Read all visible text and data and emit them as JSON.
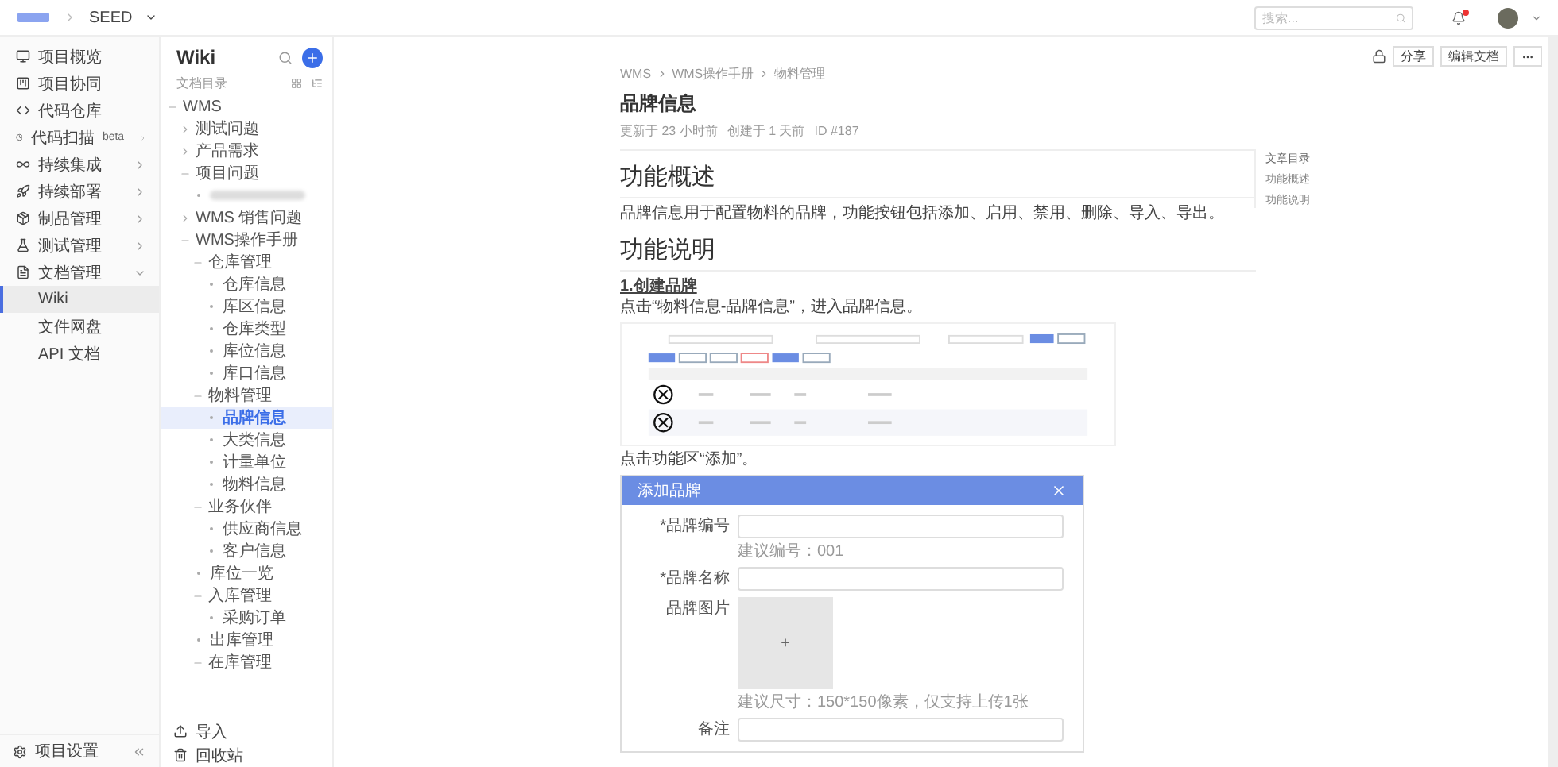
{
  "topbar": {
    "breadcrumb": [
      "SEED"
    ],
    "search": {
      "placeholder": "搜索..."
    },
    "notifications": {
      "unread": true
    }
  },
  "nav": {
    "items": [
      {
        "label": "项目概览",
        "selected": false
      },
      {
        "label": "项目协同",
        "selected": false
      },
      {
        "label": "代码仓库",
        "selected": false
      },
      {
        "label": "代码扫描",
        "badge": "beta",
        "selected": false,
        "expanded": false
      },
      {
        "label": "持续集成",
        "selected": false,
        "expanded": false
      },
      {
        "label": "持续部署",
        "selected": false,
        "expanded": false
      },
      {
        "label": "制品管理",
        "selected": false,
        "expanded": false
      },
      {
        "label": "测试管理",
        "selected": false,
        "expanded": false
      },
      {
        "label": "文档管理",
        "selected": false,
        "expanded": true,
        "children": [
          {
            "label": "Wiki",
            "selected": true
          },
          {
            "label": "文件网盘",
            "selected": false
          },
          {
            "label": "API 文档",
            "selected": false
          }
        ]
      }
    ],
    "settings": "项目设置"
  },
  "wiki": {
    "title": "Wiki",
    "toc_label": "文档目录",
    "tree": [
      {
        "label": "WMS",
        "expanded": true,
        "selected": false,
        "children": [
          {
            "label": "测试问题",
            "expanded": false,
            "selected": false
          },
          {
            "label": "产品需求",
            "expanded": false,
            "selected": false
          },
          {
            "label": "项目问题",
            "expanded": true,
            "selected": false,
            "children": [
              {
                "redacted": true,
                "selected": false
              }
            ]
          },
          {
            "label": "WMS 销售问题",
            "expanded": false,
            "selected": false
          },
          {
            "label": "WMS操作手册",
            "expanded": true,
            "selected": false,
            "children": [
              {
                "label": "仓库管理",
                "expanded": true,
                "selected": false,
                "children": [
                  {
                    "label": "仓库信息",
                    "selected": false
                  },
                  {
                    "label": "库区信息",
                    "selected": false
                  },
                  {
                    "label": "仓库类型",
                    "selected": false
                  },
                  {
                    "label": "库位信息",
                    "selected": false
                  },
                  {
                    "label": "库口信息",
                    "selected": false
                  }
                ]
              },
              {
                "label": "物料管理",
                "expanded": true,
                "selected": false,
                "children": [
                  {
                    "label": "品牌信息",
                    "selected": true
                  },
                  {
                    "label": "大类信息",
                    "selected": false
                  },
                  {
                    "label": "计量单位",
                    "selected": false
                  },
                  {
                    "label": "物料信息",
                    "selected": false
                  }
                ]
              },
              {
                "label": "业务伙伴",
                "expanded": true,
                "selected": false,
                "children": [
                  {
                    "label": "供应商信息",
                    "selected": false
                  },
                  {
                    "label": "客户信息",
                    "selected": false
                  }
                ]
              },
              {
                "label": "库位一览",
                "selected": false
              },
              {
                "label": "入库管理",
                "expanded": true,
                "selected": false,
                "children": [
                  {
                    "label": "采购订单",
                    "selected": false
                  }
                ]
              },
              {
                "label": "出库管理",
                "selected": false
              },
              {
                "label": "在库管理",
                "expanded": true,
                "selected": false
              }
            ]
          }
        ]
      }
    ],
    "footer": [
      "导入",
      "回收站"
    ]
  },
  "doc": {
    "breadcrumb": [
      "WMS",
      "WMS操作手册",
      "物料管理"
    ],
    "title": "品牌信息",
    "meta": [
      "更新于 23 小时前",
      "创建于 1 天前",
      "ID #187"
    ],
    "actions": [
      "分享",
      "编辑文档"
    ],
    "toc": {
      "title": "文章目录",
      "items": [
        "功能概述",
        "功能说明"
      ]
    },
    "blocks": [
      {
        "kind": "heading",
        "text": "功能概述"
      },
      {
        "kind": "paragraph",
        "text": "品牌信息用于配置物料的品牌，功能按钮包括添加、启用、禁用、删除、导入、导出。"
      },
      {
        "kind": "heading",
        "text": "功能说明"
      },
      {
        "kind": "step",
        "text": "1.创建品牌"
      },
      {
        "kind": "paragraph",
        "text": "点击“物料信息-品牌信息”，进入品牌信息。"
      },
      {
        "kind": "screenshot"
      },
      {
        "kind": "paragraph",
        "text": "点击功能区“添加”。"
      },
      {
        "kind": "dialog",
        "title": "添加品牌",
        "fields": [
          {
            "kind": "input",
            "label": "*品牌编号",
            "hint": "建议编号：001"
          },
          {
            "kind": "input",
            "label": "*品牌名称"
          },
          {
            "kind": "upload",
            "label": "品牌图片",
            "plus": "+",
            "hint": "建议尺寸：150*150像素，仅支持上传1张"
          },
          {
            "kind": "input",
            "label": "备注"
          }
        ]
      }
    ]
  }
}
